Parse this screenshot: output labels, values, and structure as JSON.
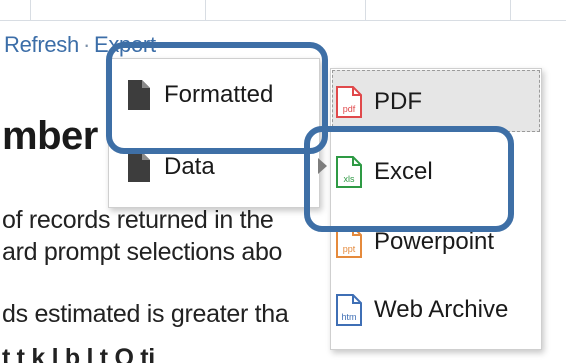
{
  "toolbar": {
    "refresh_label": "Refresh",
    "separator": "·",
    "export_label": "Export"
  },
  "page": {
    "heading": "mber",
    "lines": [
      "of records returned in the",
      "ard prompt selections abo",
      "ds estimated is greater tha",
      "t t k l b l t O ti"
    ]
  },
  "export_menu": {
    "items": [
      {
        "label": "Formatted",
        "icon": "document-icon",
        "has_submenu": false
      },
      {
        "label": "Data",
        "icon": "document-icon",
        "has_submenu": true
      }
    ]
  },
  "formatted_submenu": {
    "items": [
      {
        "label": "PDF",
        "icon": "pdf-file-icon",
        "icon_text": "pdf",
        "color": "#e0494b"
      },
      {
        "label": "Excel",
        "icon": "excel-file-icon",
        "icon_text": "xls",
        "color": "#2e9a44"
      },
      {
        "label": "Powerpoint",
        "icon": "powerpoint-file-icon",
        "icon_text": "ppt",
        "color": "#e58a3c"
      },
      {
        "label": "Web Archive",
        "icon": "web-archive-file-icon",
        "icon_text": "htm",
        "color": "#3f6fb5"
      }
    ]
  },
  "colors": {
    "callout_border": "#3e6fa6",
    "link": "#3c6ea8"
  }
}
